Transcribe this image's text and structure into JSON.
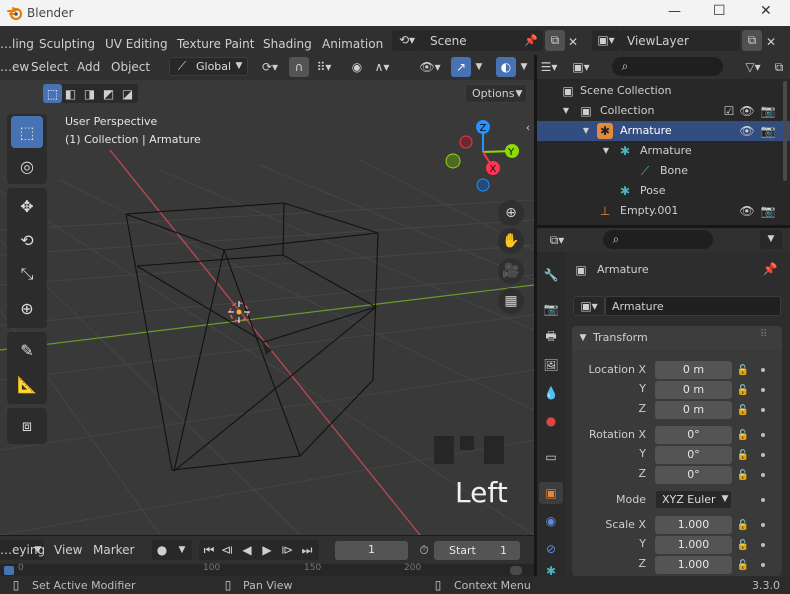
{
  "window": {
    "title": "Blender",
    "controls": [
      "—",
      "☐",
      "✕"
    ]
  },
  "menus": [
    "…ling",
    "Sculpting",
    "UV Editing",
    "Texture Paint",
    "Shading",
    "Animation"
  ],
  "scene": {
    "name": "Scene",
    "view_layer": "ViewLayer"
  },
  "header3d": {
    "view": "…ew",
    "select": "Select",
    "add": "Add",
    "object": "Object",
    "orientation": "Global",
    "options": "Options"
  },
  "viewport": {
    "perspective": "User Perspective",
    "collection": "(1) Collection | Armature",
    "side_label": "Left"
  },
  "gizmo": {
    "z": "Z",
    "y": "Y",
    "x": "X"
  },
  "outliner": {
    "search_placeholder": "",
    "items": [
      {
        "label": "Scene Collection"
      },
      {
        "label": "Collection"
      },
      {
        "label": "Armature"
      },
      {
        "label": "Armature"
      },
      {
        "label": "Bone"
      },
      {
        "label": "Pose"
      },
      {
        "label": "Empty.001"
      }
    ]
  },
  "properties": {
    "object_name": "Armature",
    "datablock": "Armature",
    "panel_title": "Transform",
    "location": {
      "x_label": "Location X",
      "y_label": "Y",
      "z_label": "Z",
      "x": "0 m",
      "y": "0 m",
      "z": "0 m"
    },
    "rotation": {
      "x_label": "Rotation X",
      "y_label": "Y",
      "z_label": "Z",
      "x": "0°",
      "y": "0°",
      "z": "0°"
    },
    "mode": {
      "label": "Mode",
      "value": "XYZ Euler"
    },
    "scale": {
      "x_label": "Scale X",
      "y_label": "Y",
      "z_label": "Z",
      "x": "1.000",
      "y": "1.000",
      "z": "1.000"
    }
  },
  "timeline": {
    "keying": "…eying",
    "view": "View",
    "marker": "Marker",
    "frame": "1",
    "start_label": "Start",
    "start": "1"
  },
  "scrub_ticks": [
    "0",
    "100",
    "150",
    "200"
  ],
  "status": {
    "left": "Set Active Modifier",
    "mid": "Pan View",
    "right": "Context Menu",
    "version": "3.3.0"
  },
  "colors": {
    "accent": "#4772b3",
    "axis_x": "#ff3352",
    "axis_y": "#8bdc00",
    "axis_z": "#2890ff",
    "active_tool": "#4772b3"
  }
}
